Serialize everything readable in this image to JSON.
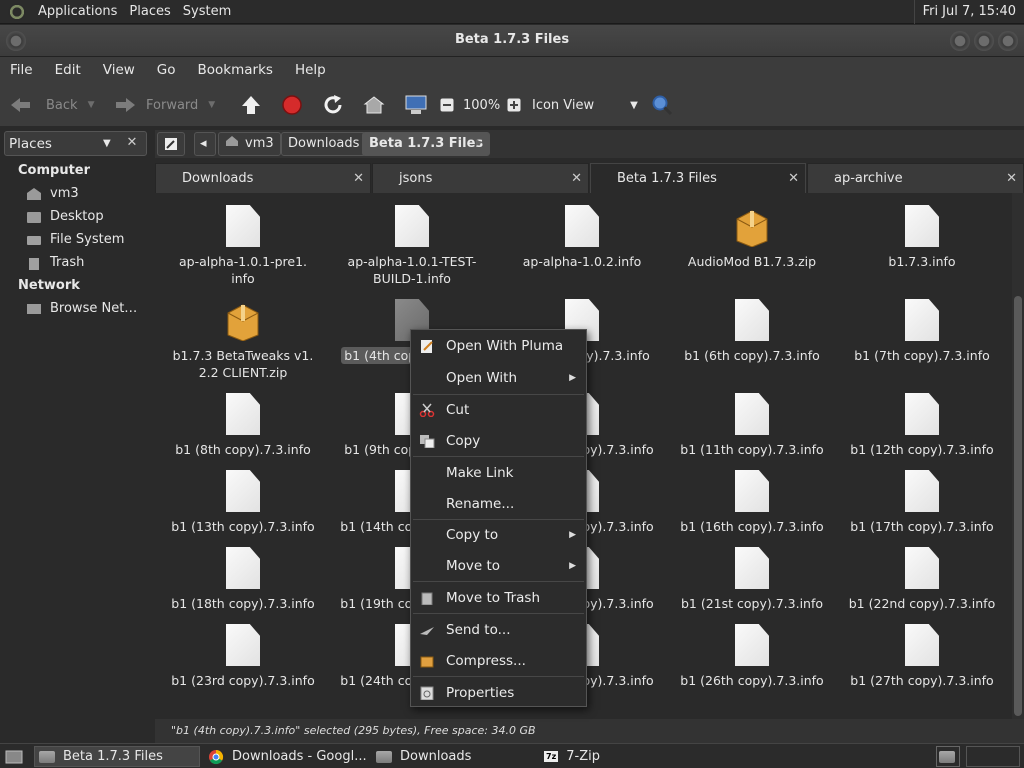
{
  "top_panel": {
    "menus": [
      "Applications",
      "Places",
      "System"
    ],
    "clock": "Fri Jul  7, 15:40"
  },
  "window": {
    "title": "Beta 1.7.3 Files"
  },
  "menubar": [
    "File",
    "Edit",
    "View",
    "Go",
    "Bookmarks",
    "Help"
  ],
  "toolbar": {
    "back": "Back",
    "forward": "Forward",
    "zoom": "100%",
    "view_mode": "Icon View"
  },
  "sidebar": {
    "header": "Places",
    "sections": [
      {
        "title": "Computer",
        "items": [
          "vm3",
          "Desktop",
          "File System",
          "Trash"
        ]
      },
      {
        "title": "Network",
        "items": [
          "Browse Net…"
        ]
      }
    ]
  },
  "pathbar": [
    "vm3",
    "Downloads",
    "Beta 1.7.3 Files"
  ],
  "tabs": [
    "Downloads",
    "jsons",
    "Beta 1.7.3 Files",
    "ap-archive"
  ],
  "files": [
    [
      "ap-alpha-1.0.1-pre1.\ninfo",
      "ap-alpha-1.0.1-TEST-\nBUILD-1.info",
      "ap-alpha-1.0.2.info",
      "AudioMod B1.7.3.zip",
      "b1.7.3.info"
    ],
    [
      "b1.7.3 BetaTweaks v1.\n2.2 CLIENT.zip",
      "b1 (4th copy).7.3.info",
      "b1 (5th copy).7.3.info",
      "b1 (6th copy).7.3.info",
      "b1 (7th copy).7.3.info"
    ],
    [
      "b1 (8th copy).7.3.info",
      "b1 (9th copy).7.3.info",
      "b1 (10th copy).7.3.info",
      "b1 (11th copy).7.3.info",
      "b1 (12th copy).7.3.info"
    ],
    [
      "b1 (13th copy).7.3.info",
      "b1 (14th copy).7.3.info",
      "b1 (15th copy).7.3.info",
      "b1 (16th copy).7.3.info",
      "b1 (17th copy).7.3.info"
    ],
    [
      "b1 (18th copy).7.3.info",
      "b1 (19th copy).7.3.info",
      "b1 (20th copy).7.3.info",
      "b1 (21st copy).7.3.info",
      "b1 (22nd copy).7.3.info"
    ],
    [
      "b1 (23rd copy).7.3.info",
      "b1 (24th copy).7.3.info",
      "b1 (25th copy).7.3.info",
      "b1 (26th copy).7.3.info",
      "b1 (27th copy).7.3.info"
    ]
  ],
  "context_menu": [
    "Open With Pluma",
    "Open With",
    "Cut",
    "Copy",
    "Make Link",
    "Rename...",
    "Copy to",
    "Move to",
    "Move to Trash",
    "Send to...",
    "Compress...",
    "Properties"
  ],
  "status": "\"b1 (4th copy).7.3.info\" selected (295 bytes), Free space: 34.0 GB",
  "taskbar": [
    "Beta 1.7.3 Files",
    "Downloads - Googl...",
    "Downloads",
    "7-Zip"
  ]
}
